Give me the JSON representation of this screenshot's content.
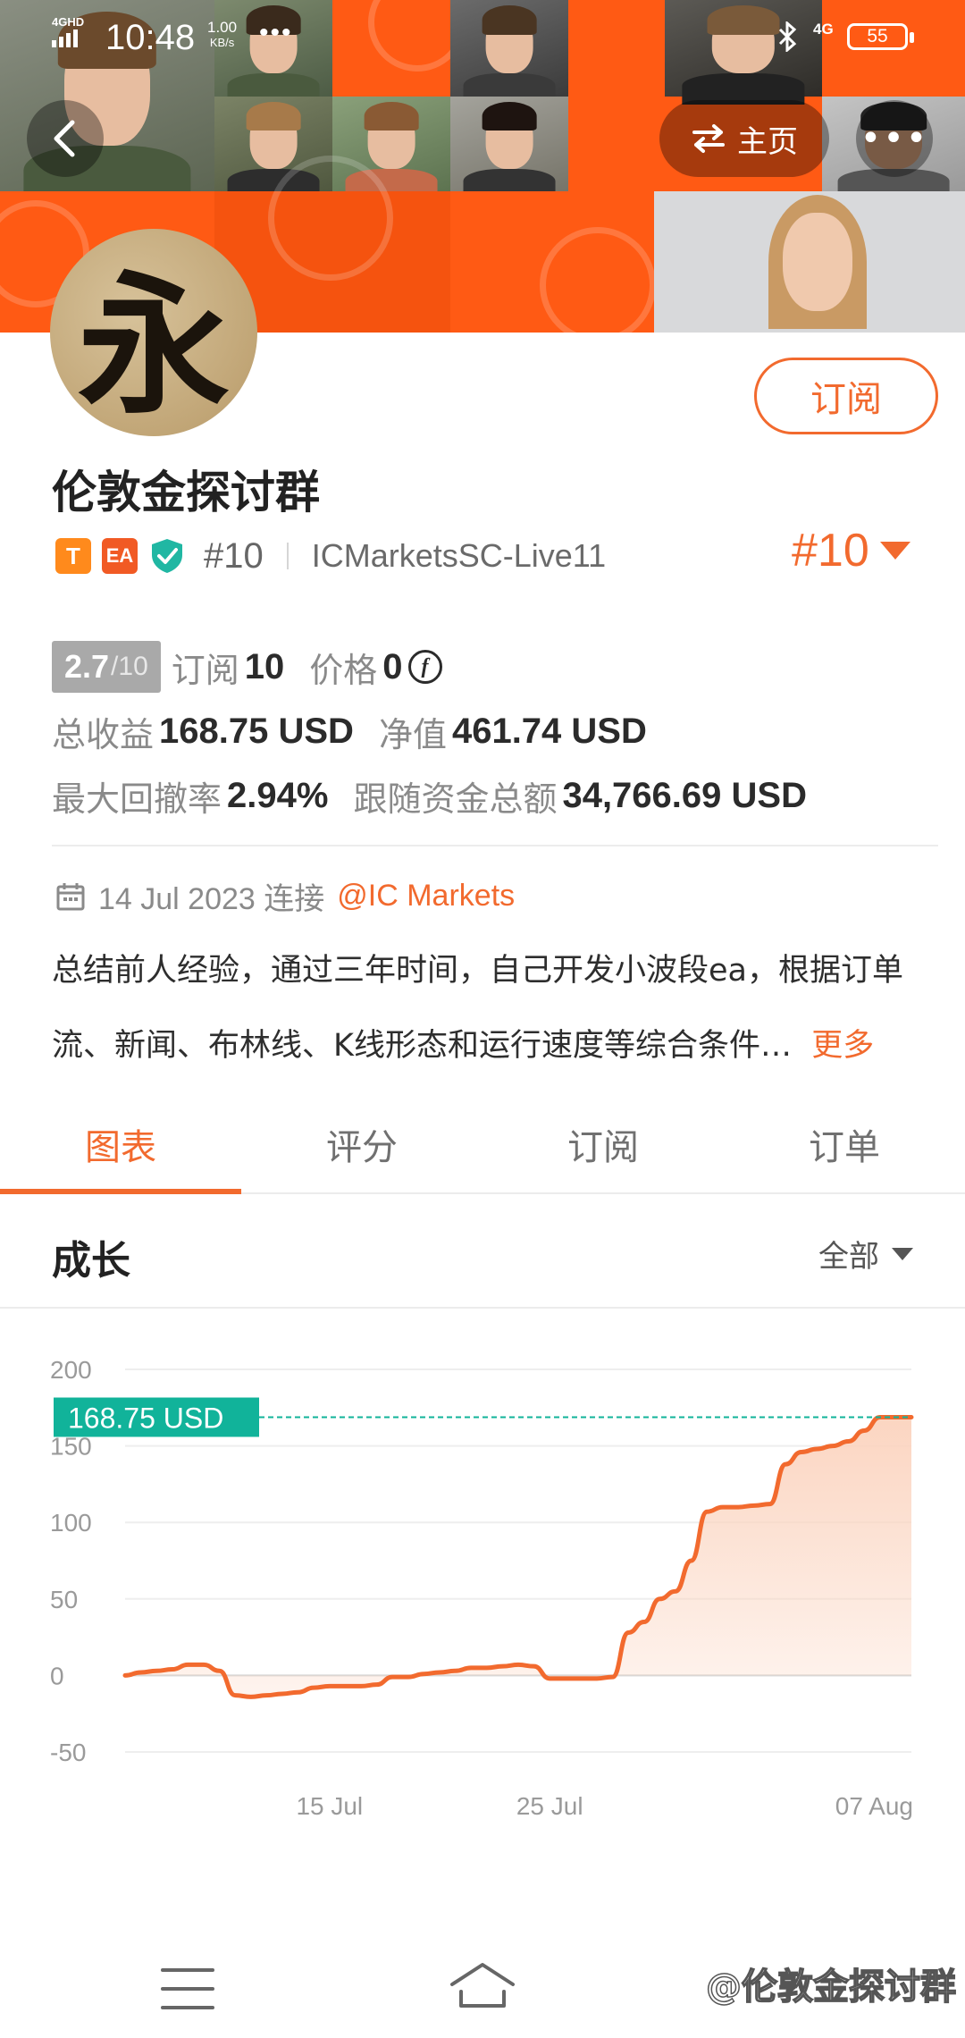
{
  "status_bar": {
    "network": "4GHD",
    "time": "10:48",
    "speed_value": "1.00",
    "speed_unit": "KB/s",
    "dots": "•••",
    "signal2": "4G",
    "battery": "55"
  },
  "header": {
    "home_label": "主页",
    "more_label": "•••"
  },
  "profile": {
    "avatar_char": "永",
    "subscribe_label": "订阅",
    "name": "伦敦金探讨群",
    "tag_t": "T",
    "tag_ea": "EA",
    "rank_small": "#10",
    "server": "ICMarketsSC-Live11",
    "rank_big": "#10"
  },
  "stats": {
    "score": "2.7",
    "score_den": "/10",
    "subscribers_label": "订阅",
    "subscribers_value": "10",
    "price_label": "价格",
    "price_value": "0",
    "coin_symbol": "f",
    "total_profit_label": "总收益",
    "total_profit_value": "168.75 USD",
    "equity_label": "净值",
    "equity_value": "461.74 USD",
    "max_drawdown_label": "最大回撤率",
    "max_drawdown_value": "2.94%",
    "follow_funds_label": "跟随资金总额",
    "follow_funds_value": "34,766.69 USD"
  },
  "about": {
    "joined_date": "14 Jul 2023 连接",
    "broker_link": "@IC Markets",
    "description": "总结前人经验，通过三年时间，自己开发小波段ea，根据订单流、新闻、布林线、K线形态和运行速度等综合条件…",
    "more_label": "更多"
  },
  "tabs": [
    {
      "label": "图表",
      "active": true
    },
    {
      "label": "评分",
      "active": false
    },
    {
      "label": "订阅",
      "active": false
    },
    {
      "label": "订单",
      "active": false
    }
  ],
  "section": {
    "title": "成长",
    "filter_label": "全部"
  },
  "chart_data": {
    "type": "area",
    "y_ticks": [
      "200",
      "150",
      "100",
      "50",
      "0",
      "-50"
    ],
    "ylim": [
      -50,
      200
    ],
    "x_ticks": [
      "15 Jul",
      "25 Jul",
      "07 Aug"
    ],
    "current_value_label": "168.75 USD",
    "current_value": 168.75,
    "line_color": "#f26a2e",
    "fill_color": "#fbd3be",
    "marker_color": "#11b39a",
    "series": [
      {
        "values": [
          0,
          2,
          3,
          4,
          7,
          7,
          3,
          -13,
          -14,
          -13,
          -12,
          -11,
          -8,
          -7,
          -7,
          -7,
          -6,
          -1,
          -1,
          1,
          2,
          3,
          5,
          5,
          6,
          7,
          6,
          -2,
          -2,
          -2,
          -2,
          -1,
          28,
          35,
          50,
          55,
          75,
          107,
          110,
          110,
          111,
          112,
          138,
          146,
          148,
          150,
          153,
          160,
          168.75,
          168.75,
          168.75
        ]
      }
    ]
  },
  "bottom_nav": {
    "watermark": "@伦敦金探讨群"
  },
  "colors": {
    "accent": "#f26a2e",
    "banner_orange": "#ff5a14",
    "teal": "#11b39a"
  }
}
